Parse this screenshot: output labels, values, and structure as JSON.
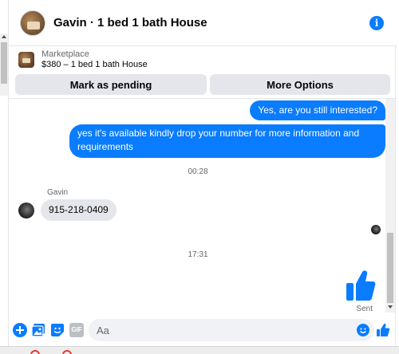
{
  "header": {
    "title": "Gavin · 1 bed 1 bath House",
    "info_icon": "i"
  },
  "listing": {
    "source": "Marketplace",
    "description": "$380 – 1 bed 1 bath House",
    "actions": {
      "pending": "Mark as pending",
      "more": "More Options"
    }
  },
  "messages": {
    "outgoing_1": "Yes, are you still interested?",
    "outgoing_2": "yes it's available kindly drop your number for more information and requirements",
    "timestamp_1": "00:28",
    "sender_name": "Gavin",
    "incoming_1": "915-218-0409",
    "timestamp_2": "17:31",
    "sent_status": "Sent"
  },
  "composer": {
    "placeholder": "Aa",
    "gif_label": "GIF"
  },
  "colors": {
    "accent": "#0a7cff",
    "bubble_in": "#e4e6eb"
  }
}
